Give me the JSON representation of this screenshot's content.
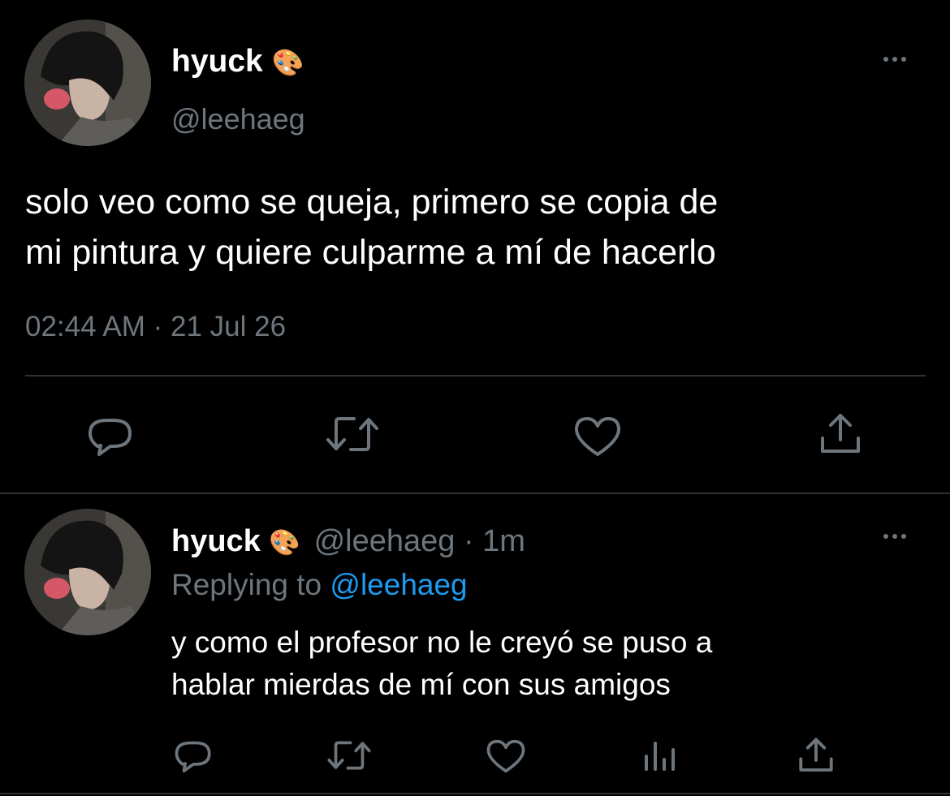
{
  "main_tweet": {
    "author_name": "hyuck",
    "author_emoji": "🎨",
    "handle": "@leehaeg",
    "text_line1": "solo veo como se queja, primero se copia de",
    "text_line2": "mi pintura y quiere culparme a mí de hacerlo",
    "timestamp": "02:44 AM · 21 Jul 26"
  },
  "reply_tweet": {
    "author_name": "hyuck",
    "author_emoji": "🎨",
    "handle_time": "@leehaeg · 1m",
    "replying_prefix": "Replying to ",
    "replying_handle": "@leehaeg",
    "text_line1": "y como el profesor no le creyó se puso a",
    "text_line2": "hablar mierdas de mí con sus amigos"
  },
  "icons": {
    "reply": "reply-icon",
    "retweet": "retweet-icon",
    "like": "like-icon",
    "share": "share-icon",
    "analytics": "analytics-icon",
    "more": "more-icon"
  },
  "colors": {
    "background": "#000000",
    "text": "#ffffff",
    "secondary": "#6e767d",
    "link": "#1d9bf0",
    "divider": "#2f3336"
  }
}
